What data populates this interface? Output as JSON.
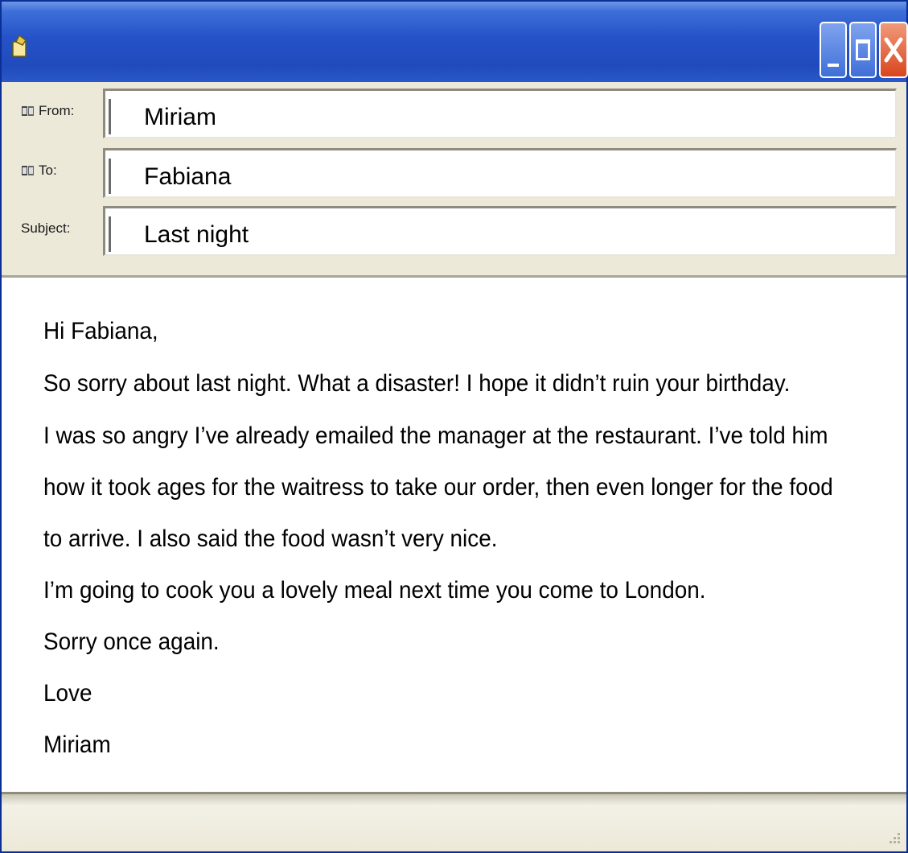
{
  "header": {
    "from": {
      "label": "From:",
      "value": "Miriam"
    },
    "to": {
      "label": "To:",
      "value": "Fabiana"
    },
    "subject": {
      "label": "Subject:",
      "value": "Last night"
    }
  },
  "body": {
    "lines": [
      "Hi Fabiana,",
      "So sorry about last night. What a disaster! I hope it didn’t ruin your birthday.",
      "I was so angry I’ve already emailed the manager at the restaurant.  I’ve told him",
      "how it took ages for the waitress to take our order, then even longer for the food",
      "to arrive.  I also said the food wasn’t very nice.",
      "I’m going to cook you a lovely meal next time you come to London.",
      "Sorry once again.",
      "Love",
      "Miriam"
    ]
  },
  "window": {
    "close_glyph": "X"
  },
  "icons": [
    "window-app-icon",
    "address-book-icon",
    "minimize-icon",
    "maximize-icon",
    "close-icon",
    "resize-grip-icon"
  ],
  "colors": {
    "titlebar": "#2552c8",
    "close_button": "#d9461f",
    "chrome": "#ece9d8"
  }
}
